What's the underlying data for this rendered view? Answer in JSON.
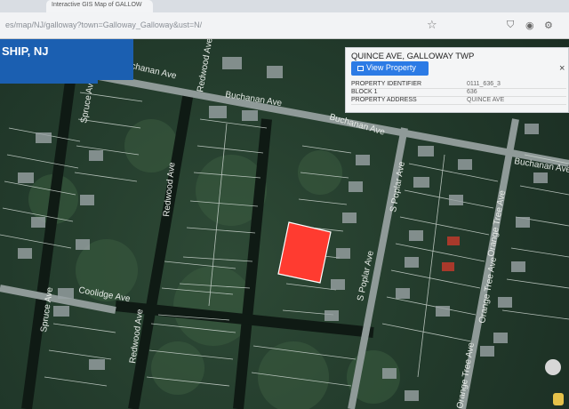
{
  "browser": {
    "tab_title": "Interactive GIS Map of GALLOW",
    "url": "es/map/NJ/galloway?town=Galloway_Galloway&ust=N/",
    "close_glyph": "×"
  },
  "left_header": {
    "title": "SHIP, NJ"
  },
  "popup": {
    "title": "QUINCE AVE, GALLOWAY TWP",
    "button_label": "View Property",
    "close_glyph": "×",
    "rows": [
      {
        "label": "PROPERTY IDENTIFIER",
        "value": "0111_636_3"
      },
      {
        "label": "BLOCK 1",
        "value": "636"
      },
      {
        "label": "PROPERTY ADDRESS",
        "value": "QUINCE AVE"
      }
    ]
  },
  "map": {
    "streets": {
      "buchanan_a": "Buchanan Ave",
      "buchanan_b": "Buchanan Ave",
      "buchanan_c": "Buchanan Ave",
      "buchanan_d": "Buchanan Ave",
      "redwood_a": "Redwood Ave",
      "redwood_b": "Redwood Ave",
      "redwood_c": "Redwood Ave",
      "spruce_a": "Spruce Ave",
      "spruce_b": "Spruce Ave",
      "coolidge": "Coolidge Ave",
      "poplar": "S Poplar Ave",
      "poplar_b": "S Poplar Ave",
      "orange_a": "Orange Tree Ave",
      "orange_b": "Orange Tree Ave",
      "orange_c": "Orange Tree Ave"
    },
    "selected_parcel_color": "#ff3b30"
  }
}
